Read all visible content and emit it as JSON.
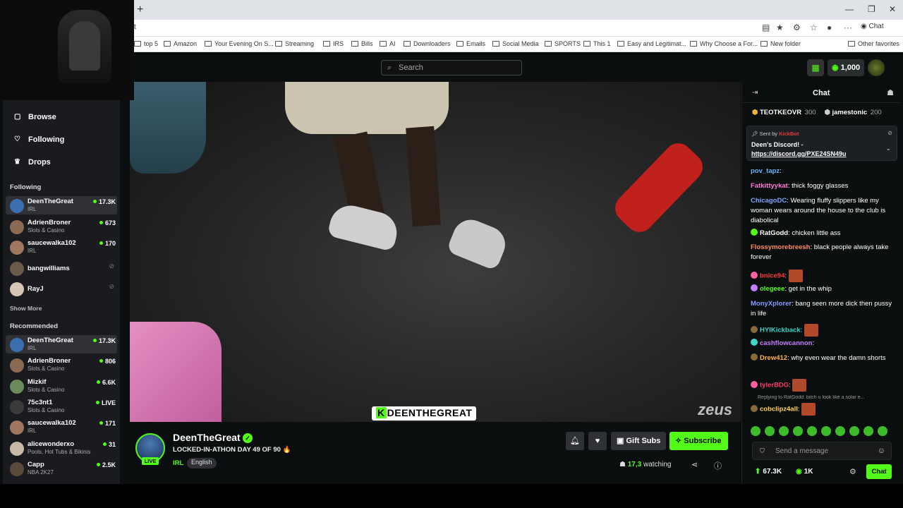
{
  "browser": {
    "url_fragment": "t",
    "chat_ext": "Chat",
    "bookmarks": [
      "top 5",
      "Amazon",
      "Your Evening On S...",
      "Streaming",
      "IRS",
      "Bills",
      "AI",
      "Downloaders",
      "Emails",
      "Social Media",
      "SPORTS",
      "This 1",
      "Easy and Legitimat...",
      "Why Choose a For...",
      "New folder",
      "Other favorites"
    ]
  },
  "topbar": {
    "search_placeholder": "Search",
    "coins": "1,000"
  },
  "sidebar": {
    "nav": [
      {
        "label": "Browse",
        "icon": "browse-icon"
      },
      {
        "label": "Following",
        "icon": "heart-icon"
      },
      {
        "label": "Drops",
        "icon": "gift-icon"
      }
    ],
    "following_title": "Following",
    "following": [
      {
        "name": "DeenTheGreat",
        "category": "IRL",
        "viewers": "17.3K",
        "live": true
      },
      {
        "name": "AdrienBroner",
        "category": "Slots & Casino",
        "viewers": "673",
        "live": true
      },
      {
        "name": "saucewalka102",
        "category": "IRL",
        "viewers": "170",
        "live": true
      },
      {
        "name": "bangwilliams",
        "category": "",
        "viewers": "",
        "live": false
      },
      {
        "name": "RayJ",
        "category": "",
        "viewers": "",
        "live": false
      }
    ],
    "show_more": "Show More",
    "recommended_title": "Recommended",
    "recommended": [
      {
        "name": "DeenTheGreat",
        "category": "IRL",
        "viewers": "17.3K"
      },
      {
        "name": "AdrienBroner",
        "category": "Slots & Casino",
        "viewers": "806"
      },
      {
        "name": "Mizkif",
        "category": "Slots & Casino",
        "viewers": "6.6K"
      },
      {
        "name": "75c3nt1",
        "category": "Slots & Casino",
        "viewers": "LIVE"
      },
      {
        "name": "saucewalka102",
        "category": "IRL",
        "viewers": "171"
      },
      {
        "name": "alicewonderxo",
        "category": "Pools, Hot Tubs & Bikinis",
        "viewers": "31"
      },
      {
        "name": "Capp",
        "category": "NBA 2K27",
        "viewers": "2.5K"
      }
    ]
  },
  "video": {
    "watermark_k": "K",
    "watermark_text": "DEENTHEGREAT",
    "brand": "zeus"
  },
  "stream": {
    "streamer": "DeenTheGreat",
    "live_label": "LIVE",
    "title": "LOCKED-IN-ATHON DAY 49 OF 90 🔥",
    "category": "IRL",
    "language": "English",
    "gift_label": "Gift Subs",
    "subscribe_label": "Subscribe",
    "viewers": "17,3",
    "watching_label": "watching"
  },
  "chat": {
    "title": "Chat",
    "leaders": [
      {
        "name": "TEOTKEOVR",
        "score": "300"
      },
      {
        "name": "jamestonic",
        "score": "200"
      }
    ],
    "pinned": {
      "sent_by": "Sent by",
      "bot": "KickBot",
      "text": "Deen's Discord! -",
      "link": "https://discord.gg/PXE24SN49u"
    },
    "messages": [
      {
        "user": "pov_tapz",
        "color": "#6ab7ff",
        "text": ""
      },
      {
        "user": "Fatkittyykat",
        "color": "#ff7ad9",
        "text": "thick foggy glasses"
      },
      {
        "user": "ChicagoDC",
        "color": "#7aa6ff",
        "text": "Wearing fluffy slippers like my woman wears around the house to the club is diabolical"
      },
      {
        "user": "RatGodd",
        "color": "#ffffff",
        "text": "chicken little ass"
      },
      {
        "user": "Flossymorebreesh",
        "color": "#ff8a65",
        "text": "black people always take forever"
      },
      {
        "user": "bnice94",
        "color": "#ff3b3b",
        "text": ""
      },
      {
        "user": "olegeee",
        "color": "#53fc18",
        "text": "get in the whip"
      },
      {
        "user": "MonyXplorer",
        "color": "#8a9bff",
        "text": "bang seen more dick then pussy in life"
      },
      {
        "user": "HYIKickback",
        "color": "#3fd4c9",
        "text": ""
      },
      {
        "user": "cashflowcannon",
        "color": "#c77dff",
        "text": ""
      },
      {
        "user": "Drew412",
        "color": "#ffb347",
        "text": "why even wear the damn shorts"
      },
      {
        "user": "tylerBDG",
        "color": "#ff3b6b",
        "text": ""
      },
      {
        "user": "cobclipz4all",
        "color": "#ffd54f",
        "text": ""
      }
    ],
    "reply_note": "Replying to RatGodd: bitch u look like a solar e...",
    "input_placeholder": "Send a message",
    "followers": "67.3K",
    "coins": "1K",
    "send_label": "Chat"
  },
  "colors": {
    "accent": "#53fc18",
    "bg": "#0b0e0f",
    "panel": "#191b1f"
  }
}
